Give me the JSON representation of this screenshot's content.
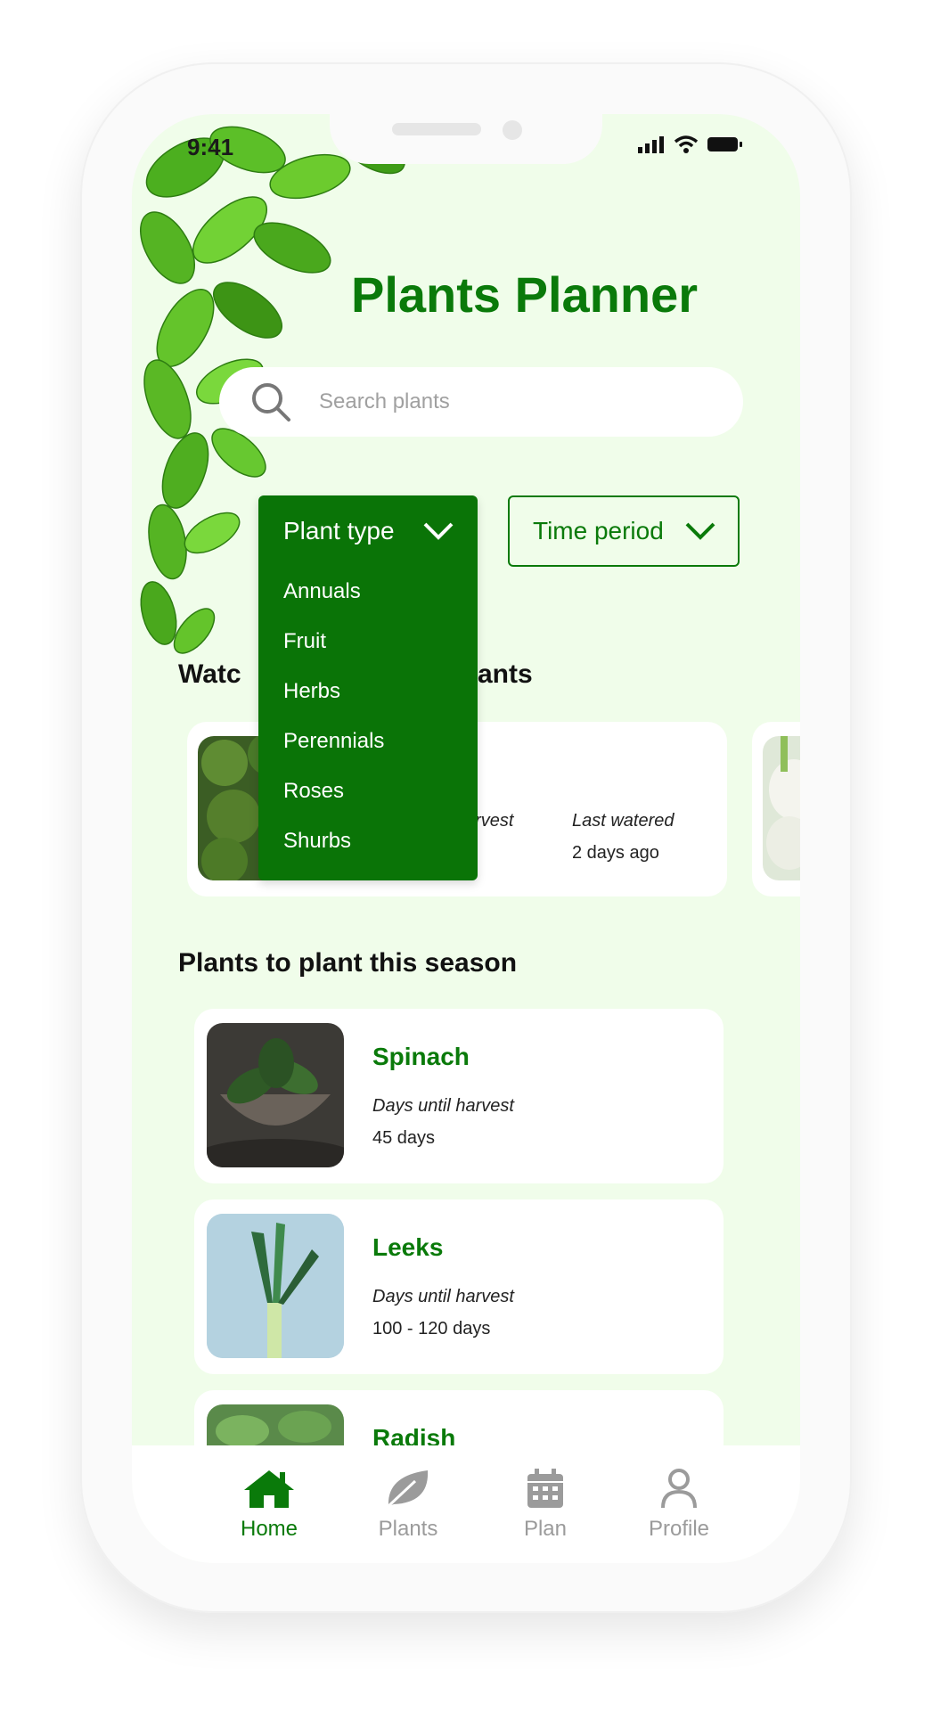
{
  "status": {
    "time": "9:41"
  },
  "header": {
    "title": "Plants Planner"
  },
  "search": {
    "placeholder": "Search plants"
  },
  "filters": {
    "plant_type": {
      "label": "Plant type",
      "options": [
        "Annuals",
        "Fruit",
        "Herbs",
        "Perennials",
        "Roses",
        "Shurbs"
      ]
    },
    "time_period": {
      "label": "Time period"
    }
  },
  "watering": {
    "title": "Watch your plants",
    "title_left": "Watc",
    "title_right": "ants",
    "card": {
      "harvest_label_partial": "arvest",
      "last_watered_label": "Last watered",
      "last_watered_value": "2 days ago"
    }
  },
  "season": {
    "title": "Plants to plant this season",
    "items": [
      {
        "name": "Spinach",
        "label": "Days until harvest",
        "value": "45 days"
      },
      {
        "name": "Leeks",
        "label": "Days until harvest",
        "value": "100 - 120 days"
      },
      {
        "name": "Radish"
      }
    ]
  },
  "nav": {
    "items": [
      {
        "label": "Home",
        "icon": "home-icon",
        "active": true
      },
      {
        "label": "Plants",
        "icon": "leaf-icon",
        "active": false
      },
      {
        "label": "Plan",
        "icon": "calendar-icon",
        "active": false
      },
      {
        "label": "Profile",
        "icon": "profile-icon",
        "active": false
      }
    ]
  },
  "colors": {
    "brand": "#0a7a0a",
    "dropdown": "#0a7407",
    "background": "#f0fdea"
  }
}
